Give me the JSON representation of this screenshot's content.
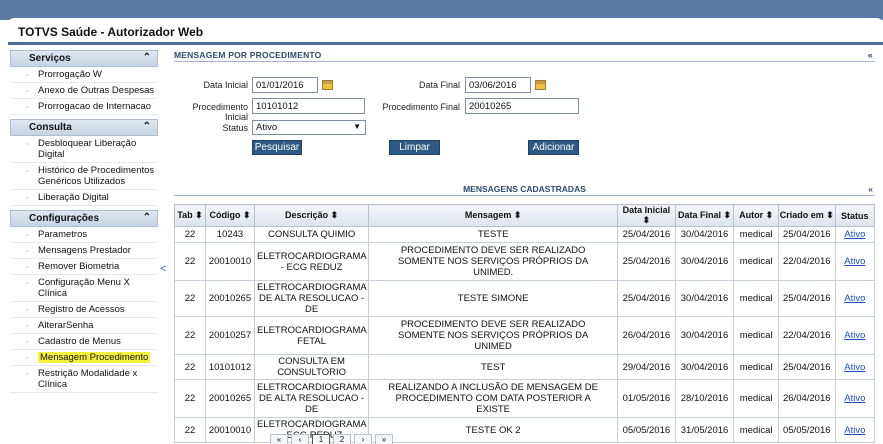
{
  "app": {
    "title": "TOTVS Saúde - Autorizador Web"
  },
  "sidebar": {
    "sections": [
      {
        "title": "Serviços",
        "items": [
          "Prorrogação W",
          "Anexo de Outras Despesas",
          "Prorrogacao de Internacao"
        ]
      },
      {
        "title": "Consulta",
        "items": [
          "Desbloquear Liberação Digital",
          "Histórico de Procedimentos Genéricos Utilizados",
          "Liberação Digital"
        ]
      },
      {
        "title": "Configurações",
        "items": [
          "Parametros",
          "Mensagens Prestador",
          "Remover Biometria",
          "Configuração Menu X Clínica",
          "Registro de Acessos",
          "AlterarSenha",
          "Cadastro de Menus",
          "Mensagem Procedimento",
          "Restrição Modalidade x Clínica"
        ]
      }
    ],
    "collapse_glyph": "<"
  },
  "form": {
    "section_title": "MENSAGEM POR PROCEDIMENTO",
    "collapse_glyph": "«",
    "data_inicial_label": "Data Inicial",
    "data_inicial_value": "01/01/2016",
    "data_final_label": "Data Final",
    "data_final_value": "03/06/2016",
    "proc_inicial_label": "Procedimento Inicial",
    "proc_inicial_value": "10101012",
    "proc_final_label": "Procedimento Final",
    "proc_final_value": "20010265",
    "status_label": "Status",
    "status_value": "Ativo",
    "pesquisar": "Pesquisar",
    "limpar": "Limpar",
    "adicionar": "Adicionar"
  },
  "list": {
    "title": "MENSAGENS CADASTRADAS",
    "collapse_glyph": "«",
    "columns": [
      "Tab ⬍",
      "Código ⬍",
      "Descrição ⬍",
      "Mensagem ⬍",
      "Data Inicial ⬍",
      "Data Final ⬍",
      "Autor ⬍",
      "Criado em ⬍",
      "Status"
    ],
    "rows": [
      [
        "22",
        "10243",
        "CONSULTA QUIMIO",
        "TESTE",
        "25/04/2016",
        "30/04/2016",
        "medical",
        "25/04/2016",
        "Ativo"
      ],
      [
        "22",
        "20010010",
        "ELETROCARDIOGRAMA - ECG REDUZ",
        "PROCEDIMENTO DEVE SER REALIZADO SOMENTE NOS SERVIÇOS PRÓPRIOS DA UNIMED.",
        "25/04/2016",
        "30/04/2016",
        "medical",
        "22/04/2016",
        "Ativo"
      ],
      [
        "22",
        "20010265",
        "ELETROCARDIOGRAMA DE ALTA RESOLUCAO - DE",
        "TESTE SIMONE",
        "25/04/2016",
        "30/04/2016",
        "medical",
        "25/04/2016",
        "Ativo"
      ],
      [
        "22",
        "20010257",
        "ELETROCARDIOGRAMA FETAL",
        "PROCEDIMENTO DEVE SER REALIZADO SOMENTE NOS SERVIÇOS PRÓPRIOS DA UNIMED",
        "26/04/2016",
        "30/04/2016",
        "medical",
        "22/04/2016",
        "Ativo"
      ],
      [
        "22",
        "10101012",
        "CONSULTA EM CONSULTORIO",
        "TEST",
        "29/04/2016",
        "30/04/2016",
        "medical",
        "25/04/2016",
        "Ativo"
      ],
      [
        "22",
        "20010265",
        "ELETROCARDIOGRAMA DE ALTA RESOLUCAO - DE",
        "REALIZANDO A INCLUSÃO DE MENSAGEM DE PROCEDIMENTO COM DATA POSTERIOR A EXISTE",
        "01/05/2016",
        "28/10/2016",
        "medical",
        "26/04/2016",
        "Ativo"
      ],
      [
        "22",
        "20010010",
        "ELETROCARDIOGRAMA - ECG REDUZ",
        "TESTE OK 2",
        "05/05/2016",
        "31/05/2016",
        "medical",
        "05/05/2016",
        "Ativo"
      ]
    ]
  },
  "pager": {
    "items": [
      "«",
      "‹",
      "1",
      "2",
      "›",
      "»"
    ],
    "current": "1"
  }
}
